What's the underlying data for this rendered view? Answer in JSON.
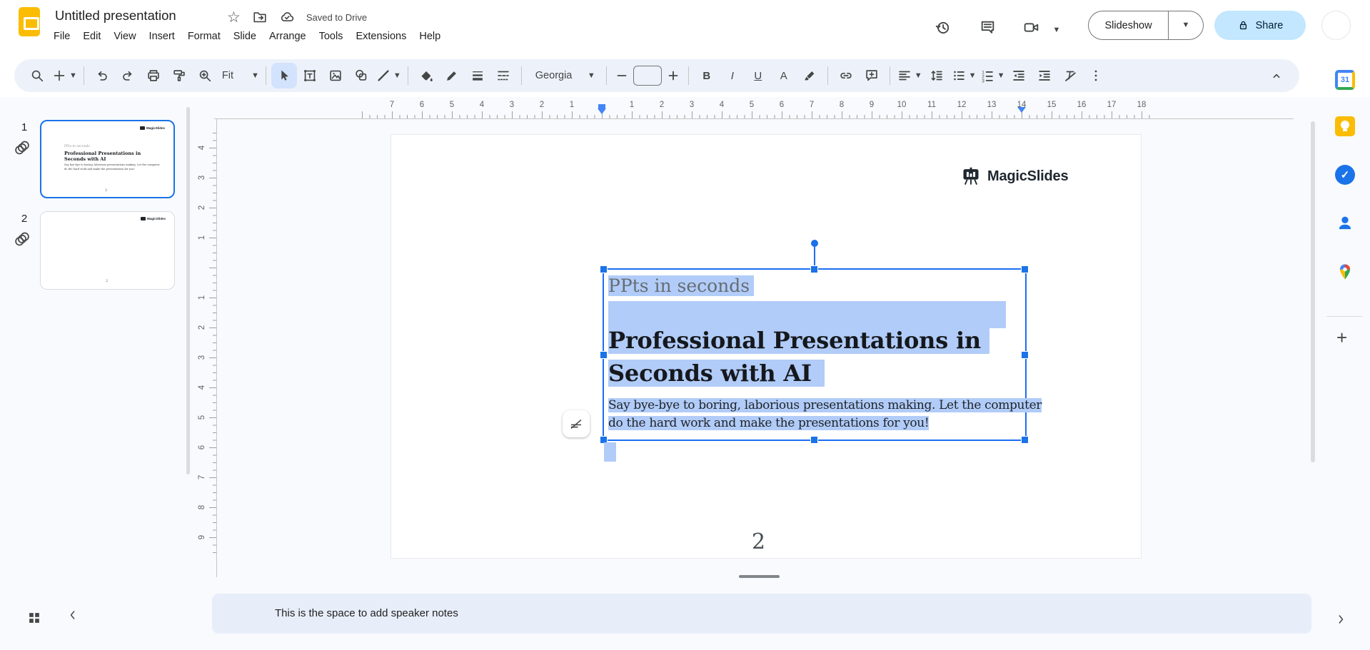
{
  "titlebar": {
    "title": "Untitled presentation",
    "saved_status": "Saved to Drive",
    "menus": [
      "File",
      "Edit",
      "View",
      "Insert",
      "Format",
      "Slide",
      "Arrange",
      "Tools",
      "Extensions",
      "Help"
    ],
    "slideshow_label": "Slideshow",
    "share_label": "Share"
  },
  "toolbar": {
    "zoom_fit_label": "Fit",
    "font_name": "Georgia",
    "font_size_value": "",
    "bold_label": "B",
    "italic_label": "I",
    "underline_label": "U",
    "text_color_label": "A"
  },
  "filmstrip": {
    "slides": [
      {
        "number": "1",
        "selected": true
      },
      {
        "number": "2",
        "selected": false
      }
    ]
  },
  "rulers": {
    "unit": "cm",
    "horizontal": [
      {
        "cm": -7,
        "label": "7"
      },
      {
        "cm": -6,
        "label": "6"
      },
      {
        "cm": -5,
        "label": "5"
      },
      {
        "cm": -4,
        "label": "4"
      },
      {
        "cm": -3,
        "label": "3"
      },
      {
        "cm": -2,
        "label": "2"
      },
      {
        "cm": -1,
        "label": "1"
      },
      {
        "cm": 1,
        "label": "1"
      },
      {
        "cm": 2,
        "label": "2"
      },
      {
        "cm": 3,
        "label": "3"
      },
      {
        "cm": 4,
        "label": "4"
      },
      {
        "cm": 5,
        "label": "5"
      },
      {
        "cm": 6,
        "label": "6"
      },
      {
        "cm": 7,
        "label": "7"
      },
      {
        "cm": 8,
        "label": "8"
      },
      {
        "cm": 9,
        "label": "9"
      },
      {
        "cm": 10,
        "label": "10"
      },
      {
        "cm": 11,
        "label": "11"
      },
      {
        "cm": 12,
        "label": "12"
      },
      {
        "cm": 13,
        "label": "13"
      },
      {
        "cm": 14,
        "label": "14"
      },
      {
        "cm": 15,
        "label": "15"
      },
      {
        "cm": 16,
        "label": "16"
      },
      {
        "cm": 17,
        "label": "17"
      },
      {
        "cm": 18,
        "label": "18"
      }
    ],
    "h_markers": [
      {
        "cm": 0,
        "type": "full"
      },
      {
        "cm": 14,
        "type": "tri"
      }
    ],
    "vertical": [
      {
        "cm": -4,
        "label": "4"
      },
      {
        "cm": -3,
        "label": "3"
      },
      {
        "cm": -2,
        "label": "2"
      },
      {
        "cm": -1,
        "label": "1"
      },
      {
        "cm": 1,
        "label": "1"
      },
      {
        "cm": 2,
        "label": "2"
      },
      {
        "cm": 3,
        "label": "3"
      },
      {
        "cm": 4,
        "label": "4"
      },
      {
        "cm": 5,
        "label": "5"
      },
      {
        "cm": 6,
        "label": "6"
      },
      {
        "cm": 7,
        "label": "7"
      },
      {
        "cm": 8,
        "label": "8"
      },
      {
        "cm": 9,
        "label": "9"
      }
    ]
  },
  "slide": {
    "brand": "MagicSlides",
    "kicker": "PPts in seconds",
    "heading_line1": "Professional Presentations in",
    "heading_line2": "Seconds with AI",
    "body_line1": "Say bye-bye to boring, laborious presentations making. Let the computer",
    "body_line2": "do the hard work and make the presentations for you!",
    "page_number": "2"
  },
  "notes": {
    "placeholder": "This is the space to add speaker notes"
  },
  "colors": {
    "accent": "#1a73e8",
    "selection_highlight": "#b1ccf8",
    "toolbar_bg": "#edf2fa",
    "active_tool_bg": "#d3e3fd",
    "share_bg": "#c2e7ff",
    "share_text": "#001d35",
    "slides_logo": "#fbbc04",
    "canvas_bg": "#f8fafd"
  }
}
